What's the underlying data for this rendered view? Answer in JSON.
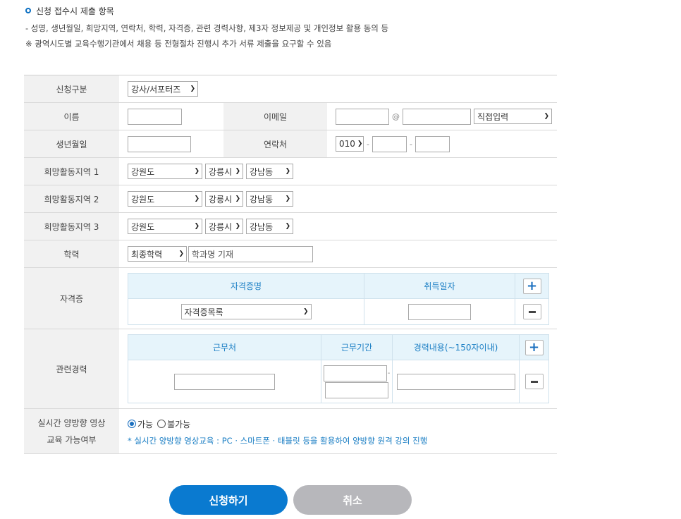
{
  "intro": {
    "title": "신청 접수시 제출 항목",
    "line1": "- 성명, 생년월일, 희망지역, 연락처, 학력, 자격증, 관련 경력사항, 제3자 정보제공 및 개인정보 활용 동의 등",
    "line2": "※ 광역시도별 교육수행기관에서 채용 등 전형절차 진행시 추가 서류 제출을 요구할 수 있음"
  },
  "form": {
    "apply_type": {
      "label": "신청구분",
      "value": "강사/서포터즈"
    },
    "name": {
      "label": "이름",
      "value": ""
    },
    "email": {
      "label": "이메일",
      "at": "@",
      "domain_select": "직접입력"
    },
    "birth": {
      "label": "생년월일",
      "value": ""
    },
    "phone": {
      "label": "연락처",
      "prefix": "010",
      "dash": "-"
    },
    "regions": [
      {
        "label": "희망활동지역 1",
        "province": "강원도",
        "city": "강릉시",
        "district": "강남동"
      },
      {
        "label": "희망활동지역 2",
        "province": "강원도",
        "city": "강릉시",
        "district": "강남동"
      },
      {
        "label": "희망활동지역 3",
        "province": "강원도",
        "city": "강릉시",
        "district": "강남동"
      }
    ],
    "education": {
      "label": "학력",
      "level": "최종학력",
      "major_placeholder": "학과명 기재"
    },
    "certificate": {
      "label": "자격증",
      "col_name": "자격증명",
      "col_date": "취득일자",
      "select_value": "자격증목록"
    },
    "career": {
      "label": "관련경력",
      "col_workplace": "근무처",
      "col_period": "근무기간",
      "col_content": "경력내용(~150자이내)",
      "period_dash": "-"
    },
    "realtime": {
      "label_line1": "실시간 양방향 영상",
      "label_line2": "교육 가능여부",
      "option_yes": "가능",
      "option_no": "불가능",
      "selected": "가능",
      "note": "* 실시간 양방향 영상교육 : PC · 스마트폰 · 태블릿 등을 활용하여 양방향 원격 강의 진행"
    }
  },
  "buttons": {
    "submit": "신청하기",
    "cancel": "취소"
  },
  "colors": {
    "accent": "#0a7ad0",
    "cancel": "#b7b7bb",
    "header_bg": "#f1f1f1",
    "sub_head_bg": "#e6f4fb",
    "note": "#1a7ec4"
  }
}
